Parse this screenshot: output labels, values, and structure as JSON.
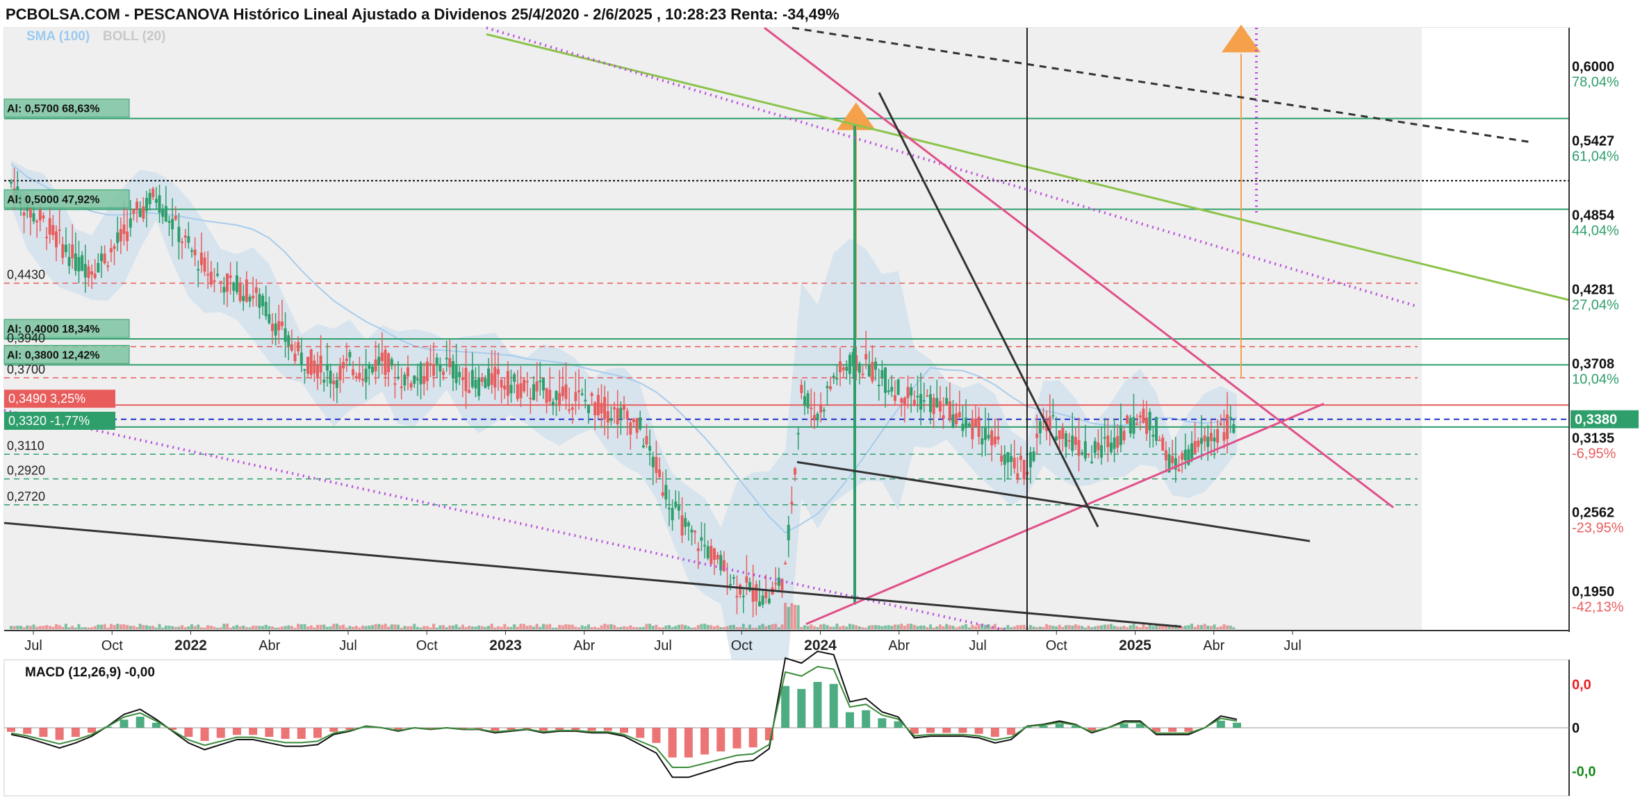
{
  "header": {
    "title": "PCBOLSA.COM - PESCANOVA Histórico Lineal Ajustado a Dividenos 25/4/2020 - 2/6/2025 , 10:28:23 Renta: -34,49%"
  },
  "legend": {
    "sma": "SMA (100)",
    "boll": "BOLL (20)"
  },
  "colors": {
    "up": "#2e9e6b",
    "down": "#e85c5c",
    "green_line": "#8bc34a",
    "pink_line": "#e0508a",
    "purple_dotted": "#b94bde",
    "dark_line": "#333333",
    "band": "#cfe0ee",
    "sma": "#a8ccec",
    "orange": "#f5a04a",
    "blue_dash": "#2233cc",
    "current": "#2e9e6b"
  },
  "x_axis": {
    "labels": [
      {
        "t": "Jul",
        "bold": false
      },
      {
        "t": "Oct",
        "bold": false
      },
      {
        "t": "2022",
        "bold": true
      },
      {
        "t": "Abr",
        "bold": false
      },
      {
        "t": "Jul",
        "bold": false
      },
      {
        "t": "Oct",
        "bold": false
      },
      {
        "t": "2023",
        "bold": true
      },
      {
        "t": "Abr",
        "bold": false
      },
      {
        "t": "Jul",
        "bold": false
      },
      {
        "t": "Oct",
        "bold": false
      },
      {
        "t": "2024",
        "bold": true
      },
      {
        "t": "Abr",
        "bold": false
      },
      {
        "t": "Jul",
        "bold": false
      },
      {
        "t": "Oct",
        "bold": false
      },
      {
        "t": "2025",
        "bold": true
      },
      {
        "t": "Abr",
        "bold": false
      },
      {
        "t": "Jul",
        "bold": false
      }
    ]
  },
  "right_axis": [
    {
      "price": "0,6000",
      "pct": "78,04%",
      "pc": "up"
    },
    {
      "price": "0,5427",
      "pct": "61,04%",
      "pc": "up"
    },
    {
      "price": "0,4854",
      "pct": "44,04%",
      "pc": "up"
    },
    {
      "price": "0,4281",
      "pct": "27,04%",
      "pc": "up"
    },
    {
      "price": "0,3708",
      "pct": "10,04%",
      "pc": "up"
    },
    {
      "price": "0,3380",
      "pct": "",
      "pc": "current"
    },
    {
      "price": "0,3135",
      "pct": "-6,95%",
      "pc": "down"
    },
    {
      "price": "0,2562",
      "pct": "-23,95%",
      "pc": "down"
    },
    {
      "price": "0,1950",
      "pct": "-42,13%",
      "pc": "down"
    }
  ],
  "alert_lines": [
    {
      "label": "Al: 0,5700  68,63%",
      "v": 0.57
    },
    {
      "label": "Al: 0,5000  47,92%",
      "v": 0.5
    },
    {
      "label": "Al: 0,4000  18,34%",
      "v": 0.4
    },
    {
      "label": "Al: 0,3800  12,42%",
      "v": 0.38
    }
  ],
  "hlines_left": [
    {
      "label": "0,4430",
      "v": 0.443,
      "style": "red-dash"
    },
    {
      "label": "0,3940",
      "v": 0.394,
      "style": "red-dash"
    },
    {
      "label": "0,3700",
      "v": 0.37,
      "style": "red-dash"
    },
    {
      "label": "0,3110",
      "v": 0.311,
      "style": "green-dash"
    },
    {
      "label": "0,2920",
      "v": 0.292,
      "style": "green-dash"
    },
    {
      "label": "0,2720",
      "v": 0.272,
      "style": "green-dash"
    }
  ],
  "price_tags": [
    {
      "label": "0,3490  3,25%",
      "v": 0.349,
      "color": "down"
    },
    {
      "label": "0,3320  -1,77%",
      "v": 0.332,
      "color": "up"
    }
  ],
  "macd": {
    "label": "MACD (12,26,9)   -0,00",
    "axis": [
      {
        "t": "0,0",
        "v": 0.045,
        "color": "#e82020"
      },
      {
        "t": "0",
        "v": 0.0,
        "color": "#111"
      },
      {
        "t": "-0,0",
        "v": -0.045,
        "color": "#1a8a1a"
      }
    ]
  },
  "chart_data": {
    "type": "line",
    "title": "PCBOLSA.COM - PESCANOVA Histórico Lineal Ajustado a Dividenos 25/4/2020 - 2/6/2025 , 10:28:23 Renta: -34,49%",
    "ylim": [
      0.175,
      0.64
    ],
    "x_ticks": [
      "Jul",
      "Oct",
      "2022",
      "Abr",
      "Jul",
      "Oct",
      "2023",
      "Abr",
      "Jul",
      "Oct",
      "2024",
      "Abr",
      "Jul",
      "Oct",
      "2025",
      "Abr",
      "Jul"
    ],
    "series": [
      {
        "values": [
          0.52,
          0.5,
          0.49,
          0.475,
          0.46,
          0.455,
          0.465,
          0.48,
          0.5,
          0.51,
          0.49,
          0.47,
          0.455,
          0.445,
          0.44,
          0.435,
          0.42,
          0.4,
          0.385,
          0.38,
          0.37,
          0.38,
          0.375,
          0.385,
          0.37,
          0.37,
          0.375,
          0.38,
          0.37,
          0.365,
          0.37,
          0.365,
          0.36,
          0.36,
          0.355,
          0.355,
          0.35,
          0.345,
          0.34,
          0.33,
          0.3,
          0.27,
          0.25,
          0.24,
          0.225,
          0.21,
          0.205,
          0.2,
          0.22,
          0.36,
          0.34,
          0.37,
          0.38,
          0.38,
          0.37,
          0.36,
          0.355,
          0.35,
          0.345,
          0.335,
          0.33,
          0.32,
          0.3,
          0.3,
          0.335,
          0.33,
          0.32,
          0.31,
          0.32,
          0.33,
          0.34,
          0.33,
          0.3,
          0.31,
          0.32,
          0.33,
          0.335
        ]
      }
    ]
  }
}
